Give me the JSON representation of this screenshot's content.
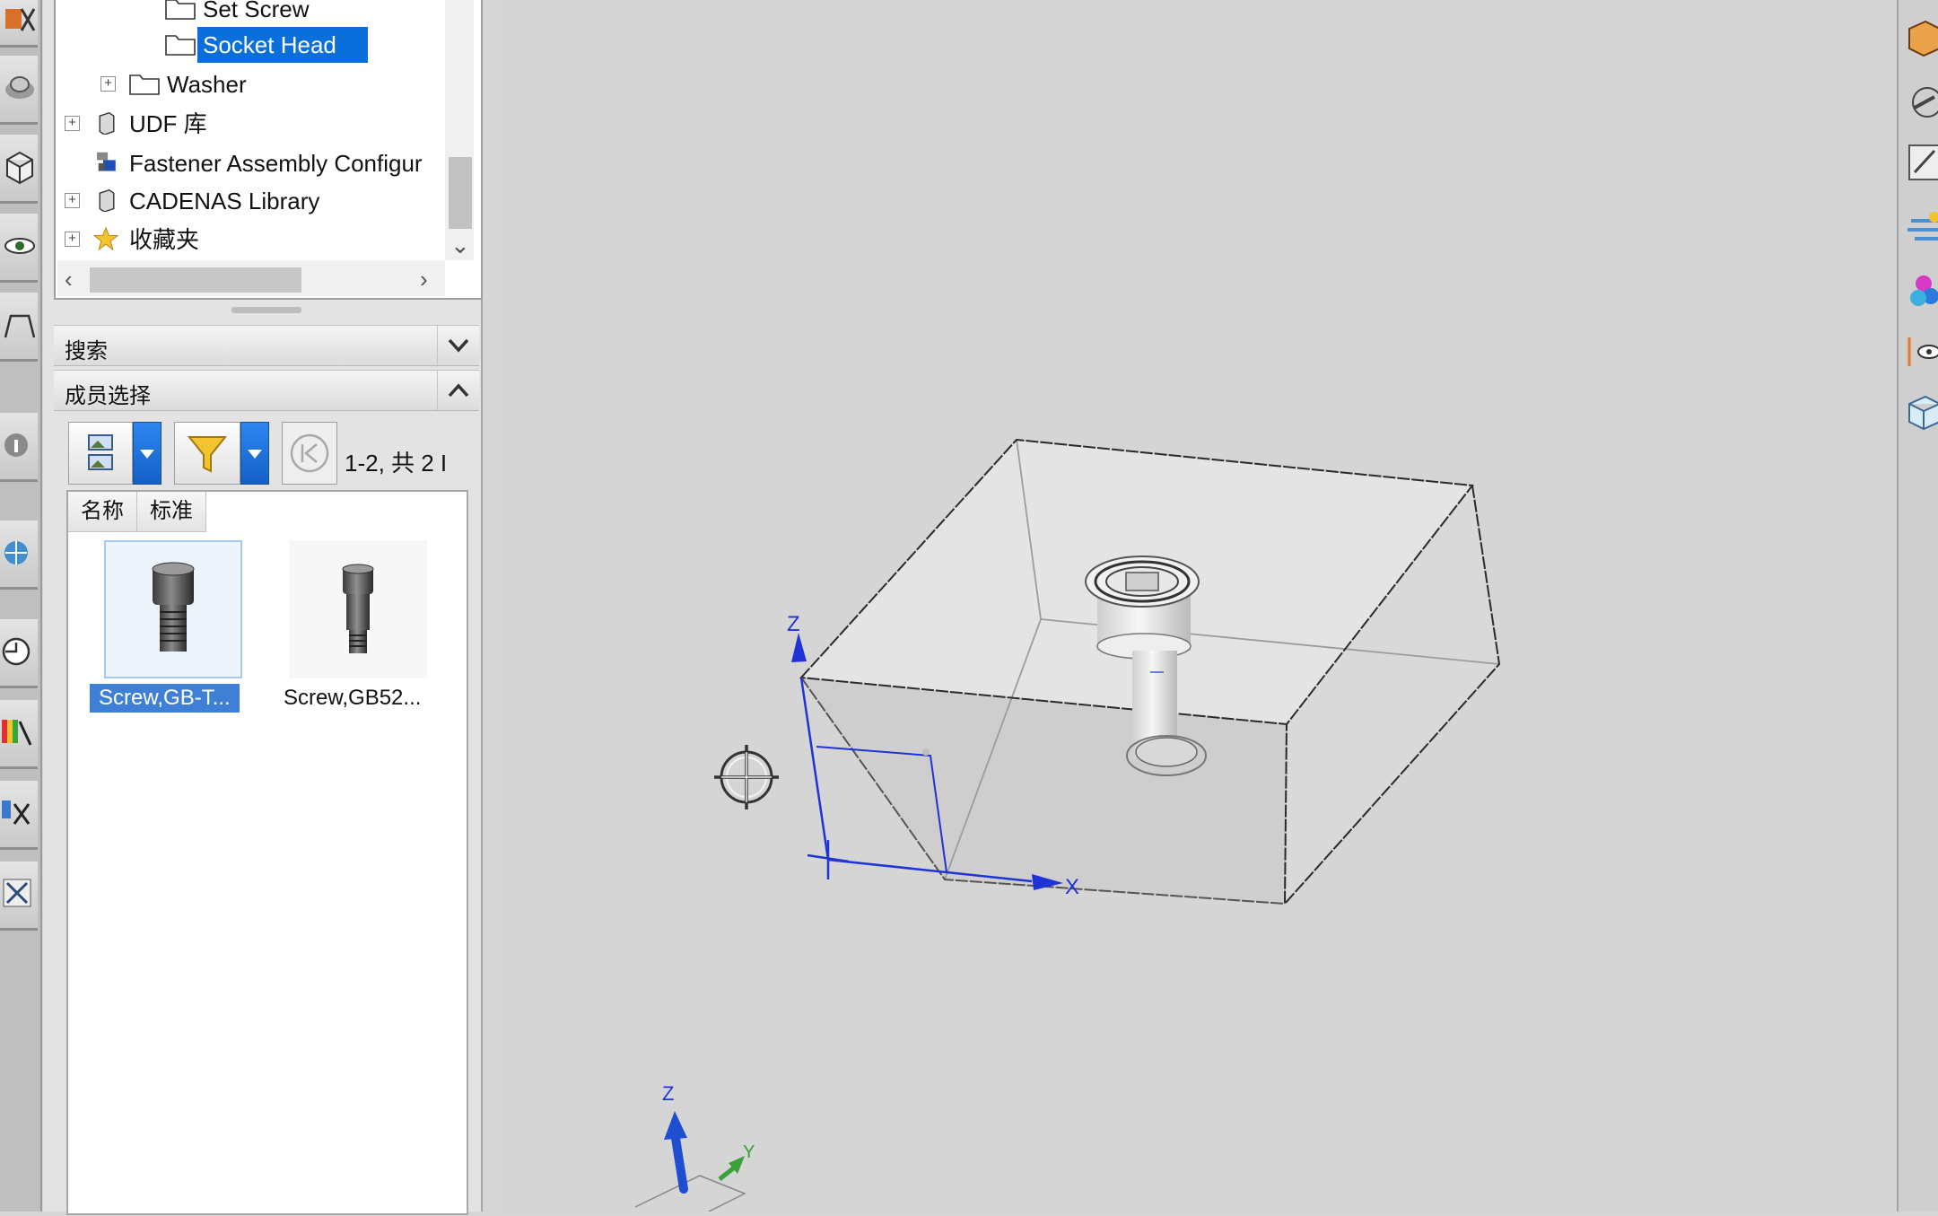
{
  "tree": {
    "items": [
      {
        "label": "Set Screw"
      },
      {
        "label": "Socket Head",
        "selected": true
      },
      {
        "label": "Washer"
      },
      {
        "label": "UDF 库"
      },
      {
        "label": "Fastener Assembly Configur"
      },
      {
        "label": "CADENAS Library"
      },
      {
        "label": "收藏夹"
      }
    ]
  },
  "sections": {
    "search_title": "搜索",
    "members_title": "成员选择"
  },
  "members": {
    "page_info": "1-2, 共 2 I",
    "columns": [
      "名称",
      "标准"
    ],
    "items": [
      {
        "caption": "Screw,GB-T...",
        "selected": true
      },
      {
        "caption": "Screw,GB52..."
      }
    ]
  },
  "viewport": {
    "axis_x": "X",
    "axis_y": "Y",
    "axis_z": "Z",
    "triad_z": "Z",
    "triad_y": "Y"
  },
  "colors": {
    "selection": "#0a6fdb",
    "csys_blue": "#1f33d6",
    "triad_green": "#3aa03a"
  }
}
